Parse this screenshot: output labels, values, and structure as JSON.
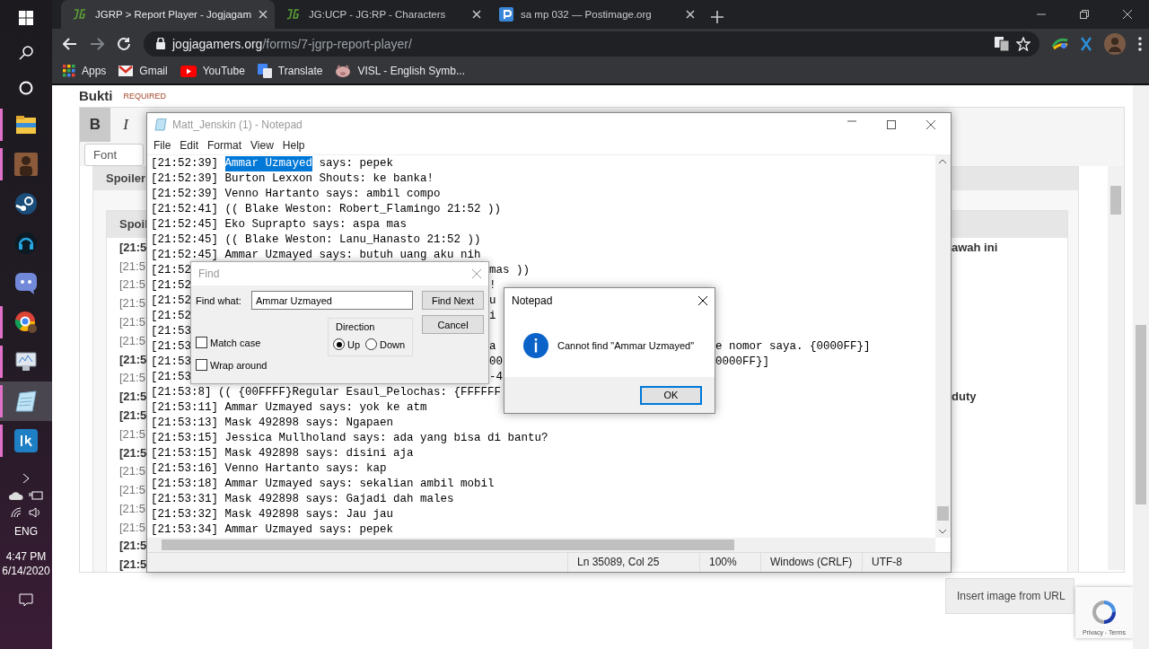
{
  "taskbar": {
    "apps": [
      {
        "kind": "folder",
        "running": true,
        "active": false
      },
      {
        "kind": "game",
        "running": true,
        "active": false
      },
      {
        "kind": "steam",
        "running": false,
        "active": false
      },
      {
        "kind": "headset",
        "running": false,
        "active": false
      },
      {
        "kind": "discord",
        "running": false,
        "active": false
      },
      {
        "kind": "chrome",
        "running": true,
        "active": false
      },
      {
        "kind": "monitor",
        "running": true,
        "active": false
      },
      {
        "kind": "notepad",
        "running": true,
        "active": true
      },
      {
        "kind": "ig",
        "running": true,
        "active": false
      }
    ],
    "language": "ENG",
    "time": "4:47 PM",
    "date": "6/14/2020"
  },
  "browser": {
    "tabs": [
      {
        "title": "JGRP > Report Player - Jogjagam",
        "kind": "jg",
        "selected": true
      },
      {
        "title": "JG:UCP - JG:RP - Characters",
        "kind": "jg",
        "selected": false
      },
      {
        "title": "sa mp 032 — Postimage.org",
        "kind": "postimage",
        "selected": false
      }
    ],
    "address": {
      "host": "jogjagamers.org",
      "path": "/forms/7-jgrp-report-player/"
    },
    "bookmarks": [
      {
        "label": "Apps",
        "kind": "apps"
      },
      {
        "label": "Gmail",
        "kind": "gmail"
      },
      {
        "label": "YouTube",
        "kind": "youtube"
      },
      {
        "label": "Translate",
        "kind": "translate"
      },
      {
        "label": "VISL - English Symb...",
        "kind": "visl"
      }
    ]
  },
  "webpage": {
    "field_label": "Bukti",
    "required": "REQUIRED",
    "format_buttons": [
      {
        "label": "B",
        "active": true
      },
      {
        "label": "I",
        "active": false
      }
    ],
    "font_select": "Font",
    "spoiler_title": "Spoiler",
    "inner_spoiler_title": "Spoil",
    "log_rows": [
      {
        "text": "[21:5",
        "bold": true,
        "tail": "awah ini"
      },
      {
        "text": "[21:5",
        "bold": false
      },
      {
        "text": "[21:5",
        "bold": false
      },
      {
        "text": "[21:5",
        "bold": false
      },
      {
        "text": "[21:5",
        "bold": false
      },
      {
        "text": "[21:5",
        "bold": false
      },
      {
        "text": "[21:5",
        "bold": true
      },
      {
        "text": "[21:5",
        "bold": false
      },
      {
        "text": "[21:5",
        "bold": true,
        "tail": "duty"
      },
      {
        "text": "[21:5",
        "bold": true
      },
      {
        "text": "[21:5",
        "bold": false
      },
      {
        "text": "[21:5",
        "bold": true
      },
      {
        "text": "[21:5",
        "bold": false
      },
      {
        "text": "[21:5",
        "bold": false
      },
      {
        "text": "[21:5",
        "bold": false
      },
      {
        "text": "[21:5",
        "bold": false
      },
      {
        "text": "[21:5",
        "bold": true
      },
      {
        "text": "[21:5",
        "bold": true
      }
    ],
    "insert_button": "Insert image from URL",
    "recaptcha": "Privacy - Terms"
  },
  "notepad": {
    "title": "Matt_Jenskin (1) - Notepad",
    "menu": [
      "File",
      "Edit",
      "Format",
      "View",
      "Help"
    ],
    "lines": [
      {
        "parts": [
          {
            "text": "[21:52:39] ",
            "kind": "inline"
          },
          {
            "text": "Ammar Uzmayed",
            "kind": "selection"
          },
          {
            "text": " says: pepek",
            "kind": "inline"
          }
        ]
      },
      {
        "parts": [
          {
            "text": "[21:52:39] Burton Lexxon Shouts: ke banka!",
            "kind": "inline"
          }
        ]
      },
      {
        "parts": [
          {
            "text": "[21:52:39] Venno Hartanto says: ambil compo",
            "kind": "inline"
          }
        ]
      },
      {
        "parts": [
          {
            "text": "[21:52:41] (( Blake Weston: Robert_Flamingo 21:52 ))",
            "kind": "inline"
          }
        ]
      },
      {
        "parts": [
          {
            "text": "[21:52:45] Eko Suprapto says: aspa mas",
            "kind": "inline"
          }
        ]
      },
      {
        "parts": [
          {
            "text": "[21:52:45] (( Blake Weston: Lanu_Hanasto 21:52 ))",
            "kind": "inline"
          }
        ]
      },
      {
        "parts": [
          {
            "text": "[21:52:45] Ammar Uzmayed says: butuh uang aku nih",
            "kind": "inline"
          }
        ]
      },
      {
        "parts": [
          {
            "text": "[21:52",
            "kind": "inline"
          },
          {
            "text": "mas ))",
            "kind": "midfield"
          }
        ]
      },
      {
        "parts": [
          {
            "text": "[21:52",
            "kind": "inline"
          },
          {
            "text": "!",
            "kind": "midfield"
          }
        ]
      },
      {
        "parts": [
          {
            "text": "[21:52",
            "kind": "inline"
          },
          {
            "text": "u",
            "kind": "midfield"
          }
        ]
      },
      {
        "parts": [
          {
            "text": "[21:52",
            "kind": "inline"
          },
          {
            "text": "i",
            "kind": "midfield"
          }
        ]
      },
      {
        "parts": [
          {
            "text": "[21:53",
            "kind": "inline"
          }
        ]
      },
      {
        "parts": [
          {
            "text": "[21:53",
            "kind": "inline"
          },
          {
            "text": "a",
            "kind": "midfield"
          },
          {
            "text": "e nomor saya. {0000FF}]",
            "kind": "rightfield"
          }
        ]
      },
      {
        "parts": [
          {
            "text": "[21:53",
            "kind": "inline"
          },
          {
            "text": "00",
            "kind": "midfield"
          },
          {
            "text": "0000FF}]",
            "kind": "rightfield"
          }
        ]
      },
      {
        "parts": [
          {
            "text": "[21:53",
            "kind": "inline"
          },
          {
            "text": "-4",
            "kind": "midfield"
          }
        ]
      },
      {
        "parts": [
          {
            "text": "[21:53:8] (( {00FFFF}Regular Esaul_Pelochas: {FFFFFF",
            "kind": "inline"
          }
        ]
      },
      {
        "parts": [
          {
            "text": "[21:53:11] Ammar Uzmayed says: yok ke atm",
            "kind": "inline"
          }
        ]
      },
      {
        "parts": [
          {
            "text": "[21:53:13] Mask 492898 says: Ngapaen",
            "kind": "inline"
          }
        ]
      },
      {
        "parts": [
          {
            "text": "[21:53:15] Jessica Mullholand says: ada yang bisa di bantu?",
            "kind": "inline"
          }
        ]
      },
      {
        "parts": [
          {
            "text": "[21:53:15] Mask 492898 says: disini aja",
            "kind": "inline"
          }
        ]
      },
      {
        "parts": [
          {
            "text": "[21:53:16] Venno Hartanto says: kap",
            "kind": "inline"
          }
        ]
      },
      {
        "parts": [
          {
            "text": "[21:53:18] Ammar Uzmayed says: sekalian ambil mobil",
            "kind": "inline"
          }
        ]
      },
      {
        "parts": [
          {
            "text": "[21:53:31] Mask 492898 says: Gajadi dah males",
            "kind": "inline"
          }
        ]
      },
      {
        "parts": [
          {
            "text": "[21:53:32] Mask 492898 says: Jau jau",
            "kind": "inline"
          }
        ]
      },
      {
        "parts": [
          {
            "text": "[21:53:34] Ammar Uzmayed says: pepek",
            "kind": "inline"
          }
        ]
      }
    ],
    "status": [
      "Ln 35089, Col 25",
      "100%",
      "Windows (CRLF)",
      "UTF-8"
    ]
  },
  "find_dialog": {
    "title": "Find",
    "label": "Find what:",
    "value": "Ammar Uzmayed",
    "buttons": [
      "Find Next",
      "Cancel"
    ],
    "direction_label": "Direction",
    "directions": [
      {
        "label": "Up",
        "selected": true
      },
      {
        "label": "Down",
        "selected": false
      }
    ],
    "options": [
      {
        "label": "Match case",
        "checked": false
      },
      {
        "label": "Wrap around",
        "checked": false
      }
    ]
  },
  "message_box": {
    "title": "Notepad",
    "text": "Cannot find \"Ammar Uzmayed\"",
    "button": "OK"
  }
}
